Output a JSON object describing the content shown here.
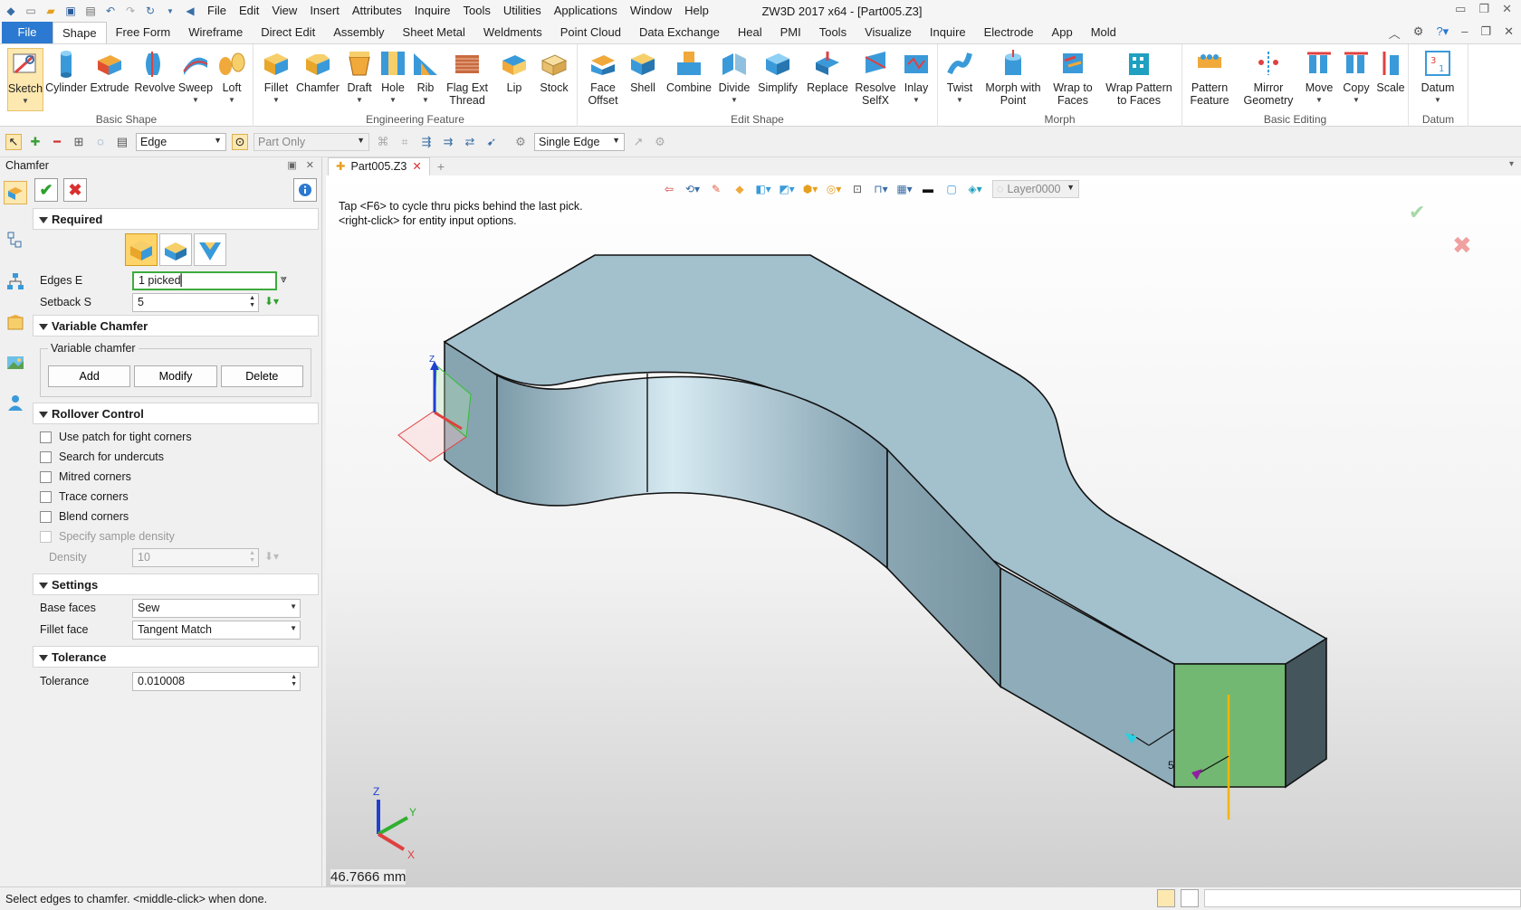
{
  "titlebar": {
    "title": "ZW3D 2017  x64 - [Part005.Z3]",
    "menu": [
      "File",
      "Edit",
      "View",
      "Insert",
      "Attributes",
      "Inquire",
      "Tools",
      "Utilities",
      "Applications",
      "Window",
      "Help"
    ]
  },
  "ribbon_tabs": [
    "File",
    "Shape",
    "Free Form",
    "Wireframe",
    "Direct Edit",
    "Assembly",
    "Sheet Metal",
    "Weldments",
    "Point Cloud",
    "Data Exchange",
    "Heal",
    "PMI",
    "Tools",
    "Visualize",
    "Inquire",
    "Electrode",
    "App",
    "Mold"
  ],
  "ribbon": {
    "groups": {
      "basic_shape": "Basic Shape",
      "engineering_feature": "Engineering Feature",
      "edit_shape": "Edit Shape",
      "morph": "Morph",
      "basic_editing": "Basic Editing",
      "datum": "Datum"
    },
    "buttons": {
      "sketch": "Sketch",
      "cylinder": "Cylinder",
      "extrude": "Extrude",
      "revolve": "Revolve",
      "sweep": "Sweep",
      "loft": "Loft",
      "fillet": "Fillet",
      "chamfer": "Chamfer",
      "draft": "Draft",
      "hole": "Hole",
      "rib": "Rib",
      "flag_ext_thread_1": "Flag Ext",
      "flag_ext_thread_2": "Thread",
      "lip": "Lip",
      "stock": "Stock",
      "face_offset_1": "Face",
      "face_offset_2": "Offset",
      "shell": "Shell",
      "combine": "Combine",
      "divide": "Divide",
      "simplify": "Simplify",
      "replace": "Replace",
      "resolve_selfx_1": "Resolve",
      "resolve_selfx_2": "SelfX",
      "inlay": "Inlay",
      "twist": "Twist",
      "morph_point_1": "Morph with",
      "morph_point_2": "Point",
      "wrap_faces_1": "Wrap to",
      "wrap_faces_2": "Faces",
      "wrap_pattern_1": "Wrap Pattern",
      "wrap_pattern_2": "to Faces",
      "pattern_feature_1": "Pattern",
      "pattern_feature_2": "Feature",
      "mirror_geometry_1": "Mirror",
      "mirror_geometry_2": "Geometry",
      "move": "Move",
      "copy": "Copy",
      "scale": "Scale",
      "datum": "Datum"
    }
  },
  "toolbar2": {
    "filter": "Edge",
    "scope": "Part Only",
    "pick_mode": "Single Edge"
  },
  "panel": {
    "title": "Chamfer",
    "sections": {
      "required": "Required",
      "variable": "Variable Chamfer",
      "rollover": "Rollover Control",
      "settings": "Settings",
      "tolerance": "Tolerance"
    },
    "edges_label": "Edges E",
    "edges_value": "1 picked",
    "setback_label": "Setback S",
    "setback_value": "5",
    "variable_legend": "Variable chamfer",
    "btn_add": "Add",
    "btn_modify": "Modify",
    "btn_delete": "Delete",
    "checks": [
      "Use patch for tight corners",
      "Search for undercuts",
      "Mitred corners",
      "Trace corners",
      "Blend corners"
    ],
    "check_density": "Specify sample density",
    "density_label": "Density",
    "density_value": "10",
    "base_faces_label": "Base faces",
    "base_faces_value": "Sew",
    "fillet_face_label": "Fillet face",
    "fillet_face_value": "Tangent Match",
    "tolerance_label": "Tolerance",
    "tolerance_value": "0.010008"
  },
  "viewport": {
    "doc_tab": "Part005.Z3",
    "layer": "Layer0000",
    "hint_1": "Tap <F6> to cycle thru picks behind the last pick.",
    "hint_2": "<right-click> for entity input options.",
    "measurement": "46.7666 mm",
    "dim_label": "5",
    "axis_x": "X",
    "axis_y": "Y",
    "axis_z": "Z"
  },
  "status": {
    "message": "Select edges to chamfer.  <middle-click> when done."
  },
  "colors": {
    "part_face": "#a3c0cd",
    "part_side": "#8aa8b6",
    "selected_face": "#72b872",
    "accent_blue": "#2b79d0"
  }
}
